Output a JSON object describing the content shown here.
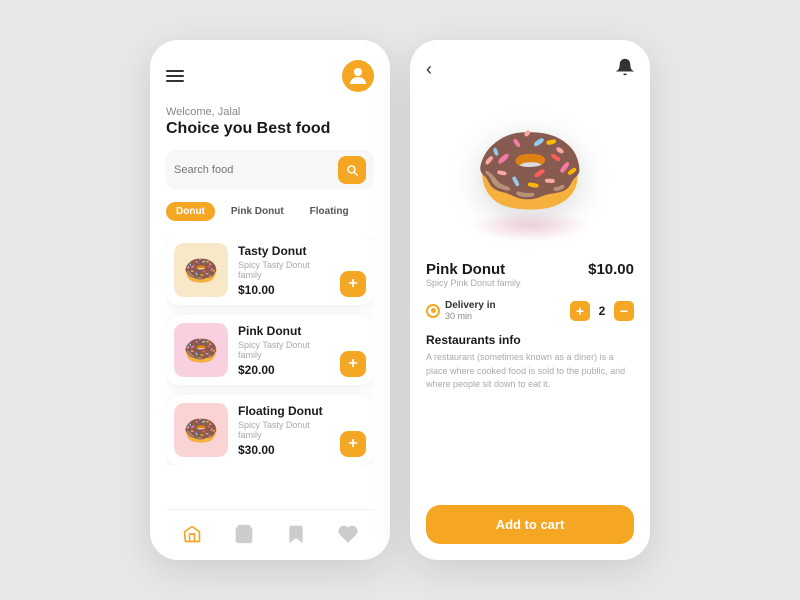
{
  "app": {
    "background": "#e8e8e8",
    "accent": "#f5a623"
  },
  "left_phone": {
    "header": {
      "welcome_label": "Welcome, Jalal",
      "title": "Choice you Best food"
    },
    "search": {
      "placeholder": "Search food"
    },
    "categories": [
      {
        "label": "Donut",
        "active": true
      },
      {
        "label": "Pink Donut",
        "active": false
      },
      {
        "label": "Floating",
        "active": false
      }
    ],
    "food_items": [
      {
        "name": "Tasty Donut",
        "desc": "Spicy Tasty Donut family",
        "price": "$10.00",
        "bg": "bg1",
        "emoji": "🍩"
      },
      {
        "name": "Pink Donut",
        "desc": "Spicy Tasty Donut family",
        "price": "$20.00",
        "bg": "bg2",
        "emoji": "🍩"
      },
      {
        "name": "Floating Donut",
        "desc": "Spicy Tasty Donut family",
        "price": "$30.00",
        "bg": "bg3",
        "emoji": "🍩"
      }
    ],
    "bottom_nav": [
      "home",
      "cart",
      "bookmark",
      "heart"
    ]
  },
  "right_phone": {
    "product": {
      "name": "Pink Donut",
      "desc": "Spicy Pink Donut family",
      "price": "$10.00",
      "emoji": "🍩"
    },
    "delivery": {
      "label": "Delivery in",
      "time": "30 min"
    },
    "quantity": 2,
    "restaurants": {
      "title": "Restaurants info",
      "desc": "A restaurant (sometimes known as a diner) is a place where cooked food is sold to the public, and where people sit down to eat it."
    },
    "add_to_cart_label": "Add to cart"
  }
}
